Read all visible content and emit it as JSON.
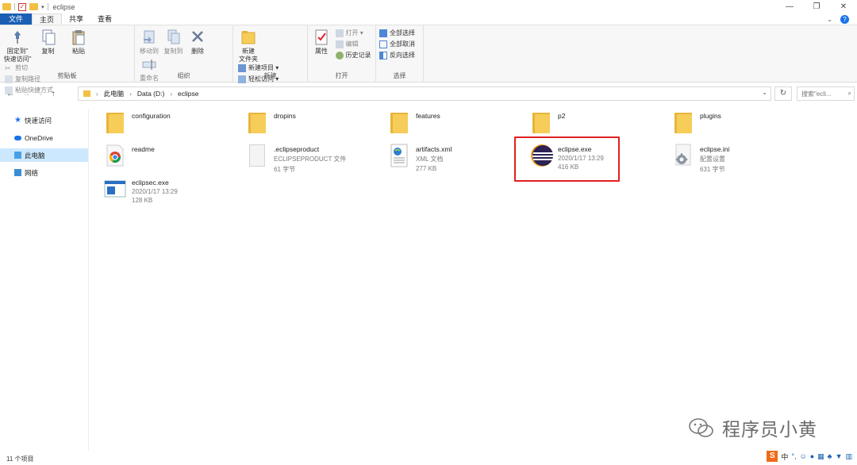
{
  "window": {
    "title": "eclipse",
    "controls": [
      "—",
      "❐",
      "✕"
    ]
  },
  "ribbon_tabs": {
    "file": "文件",
    "home": "主页",
    "share": "共享",
    "view": "查看"
  },
  "ribbon": {
    "clipboard": {
      "pin": "固定到\"\n快速访问\"",
      "copy": "复制",
      "paste": "粘贴",
      "cut": "剪切",
      "copy_path": "复制路径",
      "paste_shortcut": "粘贴快捷方式",
      "label": "剪贴板"
    },
    "organize": {
      "move_to": "移动到",
      "copy_to": "复制到",
      "delete": "删除",
      "rename": "重命名",
      "label": "组织"
    },
    "new": {
      "new_folder": "新建\n文件夹",
      "new_item": "新建项目 ▾",
      "easy_access": "轻松访问 ▾",
      "label": "新建"
    },
    "open": {
      "properties": "属性",
      "open": "打开 ▾",
      "edit": "编辑",
      "history": "历史记录",
      "label": "打开"
    },
    "select": {
      "select_all": "全部选择",
      "select_none": "全部取消",
      "invert": "反向选择",
      "label": "选择"
    }
  },
  "address": {
    "crumbs": [
      "此电脑",
      "Data (D:)",
      "eclipse"
    ],
    "search_placeholder": "搜索\"ecli..."
  },
  "sidebar": {
    "items": [
      {
        "label": "快速访问"
      },
      {
        "label": "OneDrive"
      },
      {
        "label": "此电脑"
      },
      {
        "label": "网络"
      }
    ]
  },
  "files": [
    {
      "name": "configuration",
      "sub1": "",
      "sub2": "",
      "icon": "folder-icon"
    },
    {
      "name": "dropins",
      "sub1": "",
      "sub2": "",
      "icon": "folder-icon"
    },
    {
      "name": "features",
      "sub1": "",
      "sub2": "",
      "icon": "folder-icon"
    },
    {
      "name": "p2",
      "sub1": "",
      "sub2": "",
      "icon": "folder-icon"
    },
    {
      "name": "plugins",
      "sub1": "",
      "sub2": "",
      "icon": "folder-icon"
    },
    {
      "name": "readme",
      "sub1": "",
      "sub2": "",
      "icon": "chrome-icon"
    },
    {
      "name": ".eclipseproduct",
      "sub1": "ECLIPSEPRODUCT 文件",
      "sub2": "61 字节",
      "icon": "document-icon"
    },
    {
      "name": "artifacts.xml",
      "sub1": "XML 文档",
      "sub2": "277 KB",
      "icon": "xml-document-icon"
    },
    {
      "name": "eclipse.exe",
      "sub1": "2020/1/17 13:29",
      "sub2": "416 KB",
      "icon": "eclipse-icon"
    },
    {
      "name": "eclipse.ini",
      "sub1": "配置设置",
      "sub2": "631 字节",
      "icon": "settings-file-icon"
    },
    {
      "name": "eclipsec.exe",
      "sub1": "2020/1/17 13:29",
      "sub2": "128 KB",
      "icon": "console-app-icon"
    }
  ],
  "status": {
    "count": "11 个项目"
  },
  "watermark": {
    "text": "程序员小黄"
  },
  "ime": {
    "brand": "S",
    "mode": "中"
  }
}
